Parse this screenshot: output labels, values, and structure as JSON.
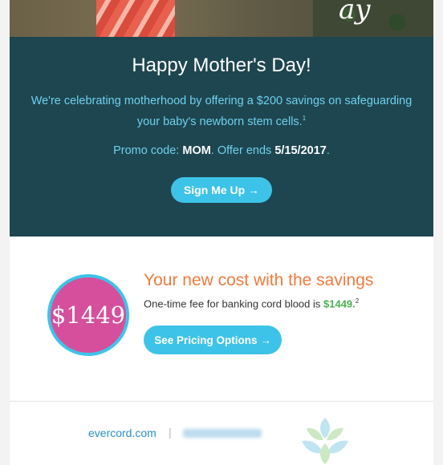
{
  "hero": {
    "script_text": "ay"
  },
  "promo": {
    "title": "Happy Mother's Day!",
    "body": "We're celebrating motherhood by offering a $200 savings on safeguarding your baby's newborn stem cells.",
    "body_footnote": "1",
    "code_label": "Promo code: ",
    "code": "MOM",
    "code_mid": ". Offer ends ",
    "end_date": "5/15/2017",
    "code_end": ".",
    "button_label": "Sign Me Up →"
  },
  "pricing": {
    "badge_price": "$1449",
    "heading": "Your new cost with the savings",
    "fee_text": "One-time fee for banking cord blood is ",
    "fee_amount": "$1449.",
    "fee_footnote": "2",
    "button_label": "See Pricing Options →"
  },
  "footer": {
    "link": "evercord.com",
    "separator": "|"
  },
  "colors": {
    "promo_bg": "#1e4650",
    "accent_cyan": "#3ec3e8",
    "heading_orange": "#f07a3d",
    "price_green": "#4caf50",
    "badge_pink": "#d64f9c"
  }
}
